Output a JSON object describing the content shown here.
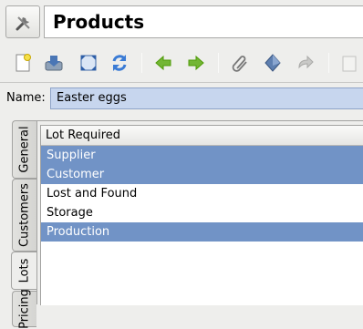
{
  "header": {
    "title": "Products",
    "icon": "tools-icon"
  },
  "toolbar": {
    "buttons": [
      {
        "name": "new-record-button",
        "icon": "new-document-icon"
      },
      {
        "name": "save-button",
        "icon": "save-icon"
      },
      {
        "name": "fullscreen-button",
        "icon": "expand-icon"
      },
      {
        "name": "refresh-button",
        "icon": "refresh-icon"
      },
      {
        "name": "previous-button",
        "icon": "arrow-left-icon"
      },
      {
        "name": "next-button",
        "icon": "arrow-right-icon"
      },
      {
        "name": "attach-button",
        "icon": "paperclip-icon"
      },
      {
        "name": "action-button",
        "icon": "gem-icon"
      },
      {
        "name": "relate-button",
        "icon": "forward-icon"
      },
      {
        "name": "print-button",
        "icon": "print-icon"
      }
    ]
  },
  "form": {
    "name_label": "Name:",
    "name_value": "Easter eggs"
  },
  "tabs": [
    {
      "label": "General",
      "active": false
    },
    {
      "label": "Customers",
      "active": false
    },
    {
      "label": "Lots",
      "active": true
    },
    {
      "label": "Pricing",
      "active": false
    }
  ],
  "lots": {
    "column_header": "Lot Required",
    "rows": [
      {
        "label": "Supplier",
        "selected": true
      },
      {
        "label": "Customer",
        "selected": true
      },
      {
        "label": "Lost and Found",
        "selected": false
      },
      {
        "label": "Storage",
        "selected": false
      },
      {
        "label": "Production",
        "selected": true
      }
    ]
  },
  "colors": {
    "selection": "#7193c6",
    "name_field": "#c7d6ee",
    "green_arrow": "#4e9a06"
  }
}
